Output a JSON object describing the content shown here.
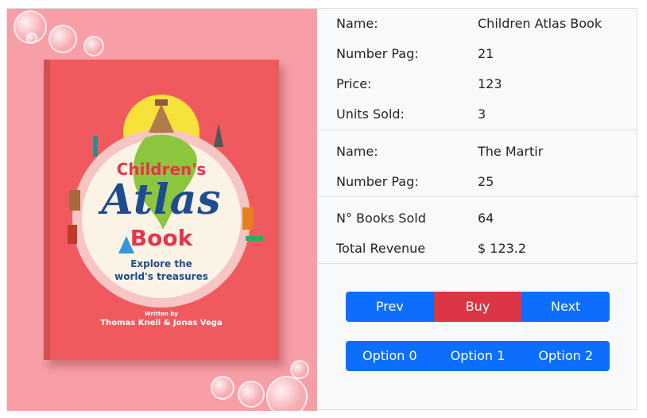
{
  "book_cover": {
    "title_line1": "Children's",
    "title_line2": "Atlas",
    "title_line3": "Book",
    "subtitle_line1": "Explore the",
    "subtitle_line2": "world's treasures",
    "written_by": "Written by",
    "authors": "Thomas Knell & Jonas Vega"
  },
  "book_details": {
    "name_label": "Name:",
    "name_value": "Children Atlas Book",
    "pages_label": "Number Pag:",
    "pages_value": "21",
    "price_label": "Price:",
    "price_value": "123",
    "units_label": "Units Sold:",
    "units_value": "3"
  },
  "author_details": {
    "name_label": "Name:",
    "name_value": "The Martir",
    "pages_label": "Number Pag:",
    "pages_value": "25"
  },
  "summary": {
    "books_sold_label": "N° Books Sold",
    "books_sold_value": "64",
    "revenue_label": "Total Revenue",
    "revenue_value": "$ 123.2"
  },
  "nav_buttons": {
    "prev": "Prev",
    "buy": "Buy",
    "next": "Next"
  },
  "option_buttons": [
    "Option 0",
    "Option 1",
    "Option 2"
  ],
  "colors": {
    "primary": "#0d6efd",
    "danger": "#dc3545",
    "panel_background": "#f79ea6",
    "cover": "#f05a5f"
  }
}
